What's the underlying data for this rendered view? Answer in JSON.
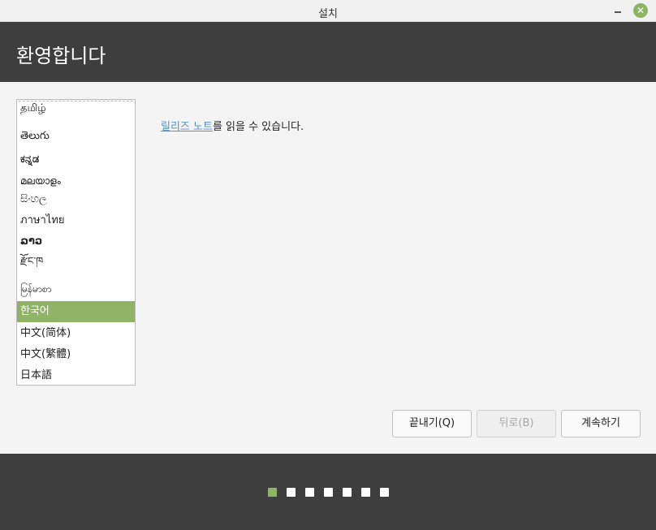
{
  "window": {
    "title": "설치"
  },
  "header": {
    "title": "환영합니다"
  },
  "languages": {
    "items": [
      {
        "label": "தமிழ்"
      },
      {
        "label": "తెలుగు"
      },
      {
        "label": "ಕನ್ನಡ"
      },
      {
        "label": "മലയാളം"
      },
      {
        "label": "සිංහල"
      },
      {
        "label": "ภาษาไทย"
      },
      {
        "label": "ລາວ"
      },
      {
        "label": "རྫོང་ཁ"
      },
      {
        "label": "မြန်မာစာ"
      },
      {
        "label": "한국어"
      },
      {
        "label": "中文(简体)"
      },
      {
        "label": "中文(繁體)"
      },
      {
        "label": "日本語"
      }
    ],
    "selected": "한국어"
  },
  "notes": {
    "link_text": "릴리즈 노트",
    "suffix": "를 읽을 수 있습니다."
  },
  "buttons": {
    "quit": "끝내기(Q)",
    "back": "뒤로(B)",
    "continue": "계속하기"
  },
  "progress": {
    "total_steps": 7,
    "current_step": 1
  },
  "colors": {
    "accent": "#8fb465",
    "header_bg": "#3e3e3e",
    "link": "#5a8fc8"
  }
}
